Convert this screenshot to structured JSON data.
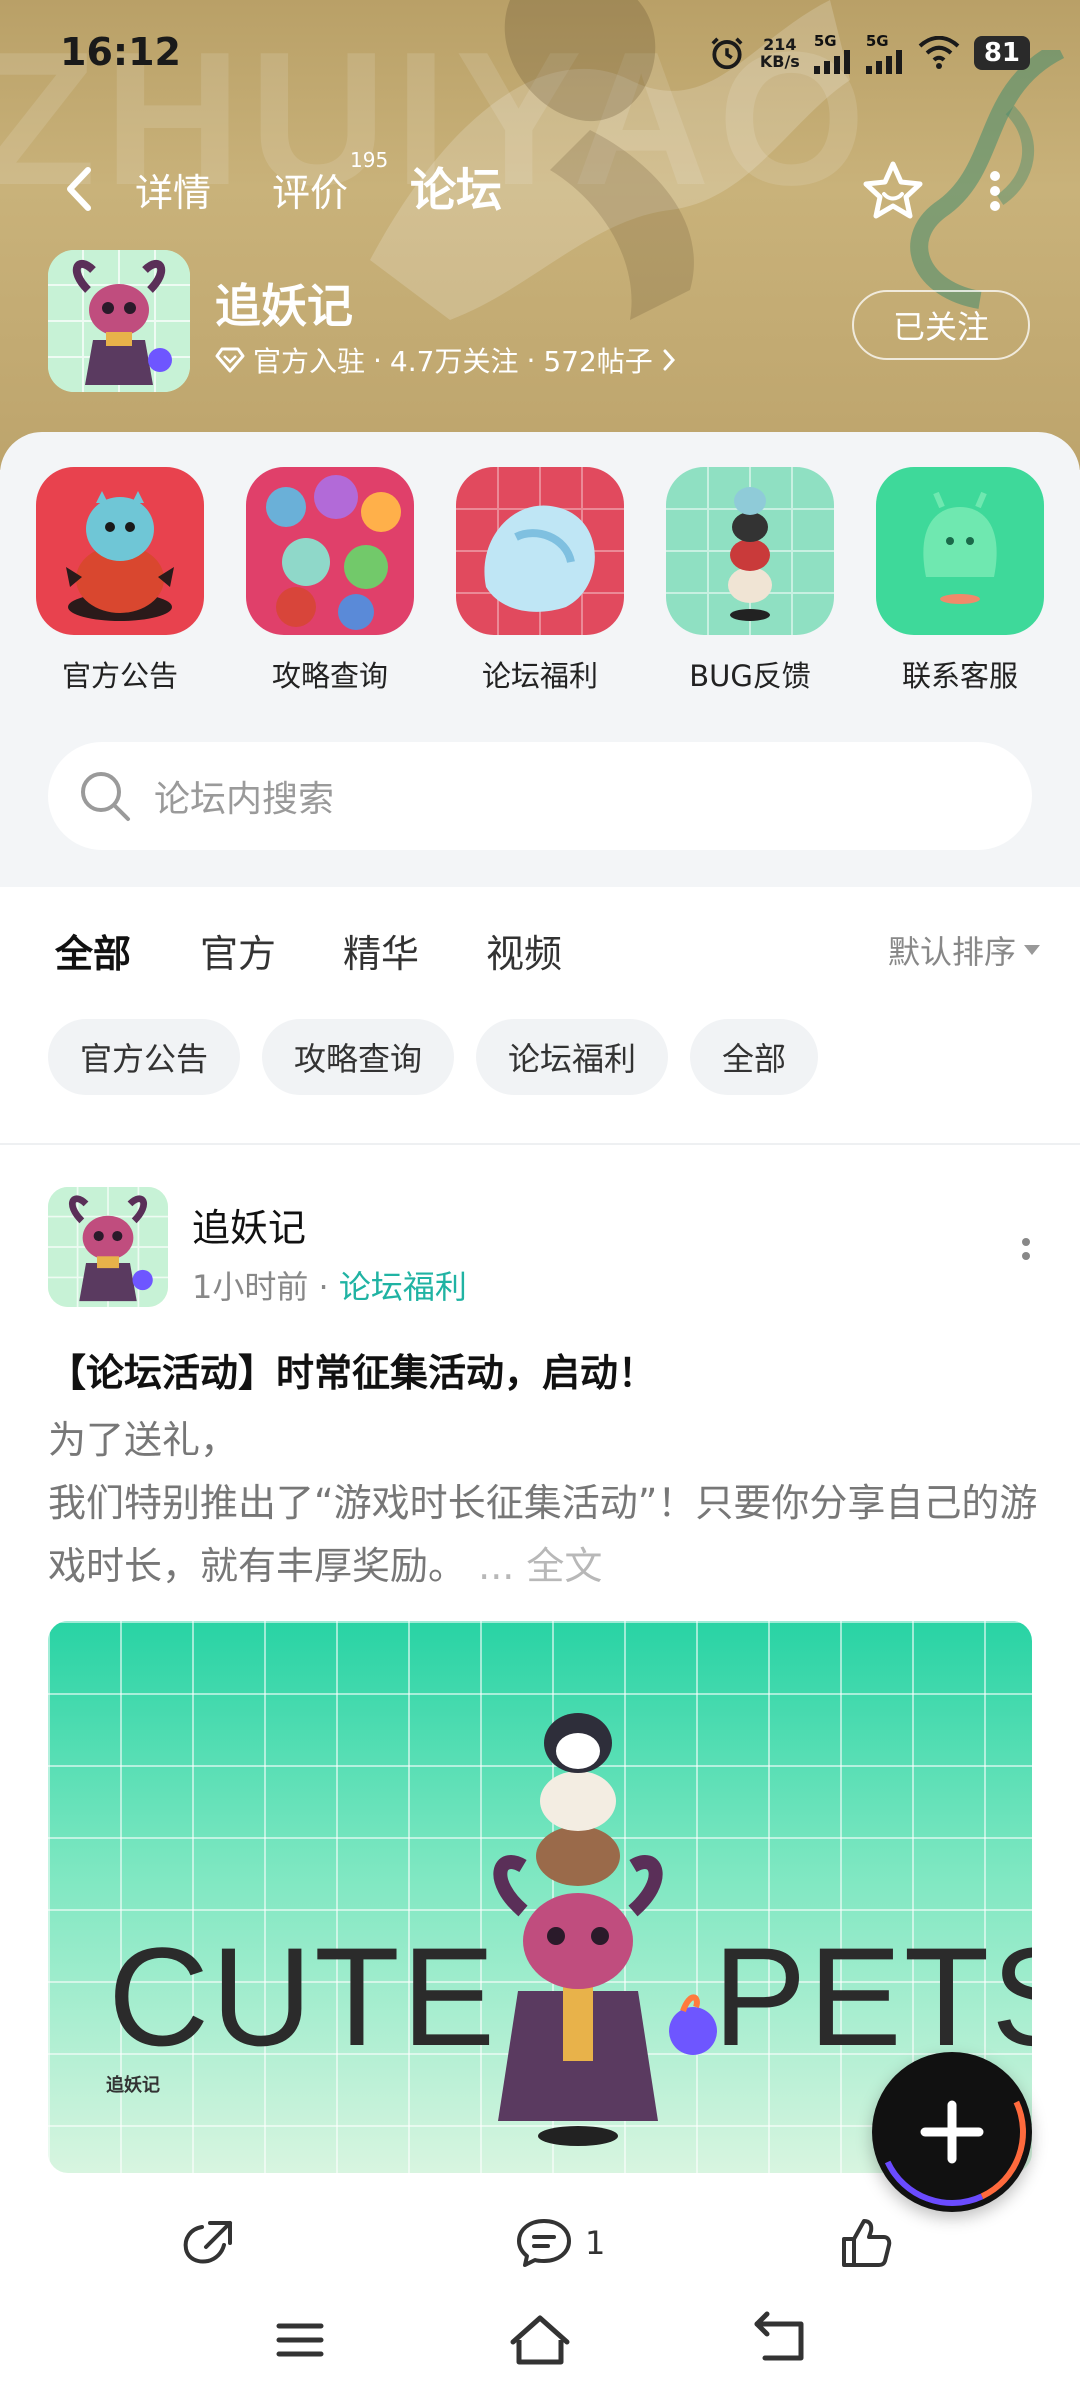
{
  "status_bar": {
    "time": "16:12",
    "network_speed": "214",
    "network_speed_unit": "KB/s",
    "signal1": "5G",
    "signal2": "5G",
    "battery": "81"
  },
  "nav": {
    "tabs": [
      {
        "label": "详情"
      },
      {
        "label": "评价",
        "badge": "195"
      },
      {
        "label": "论坛",
        "active": true
      }
    ]
  },
  "game": {
    "name": "追妖记",
    "official": "官方入驻",
    "followers": "4.7万关注",
    "posts": "572帖子",
    "follow_button": "已关注"
  },
  "shortcuts": [
    {
      "label": "官方公告",
      "icon": "red-monster-icon"
    },
    {
      "label": "攻略查询",
      "icon": "monster-group-icon"
    },
    {
      "label": "论坛福利",
      "icon": "ice-monster-icon"
    },
    {
      "label": "BUG反馈",
      "icon": "stacked-pets-icon"
    },
    {
      "label": "联系客服",
      "icon": "green-ghost-icon"
    }
  ],
  "search": {
    "placeholder": "论坛内搜索"
  },
  "filter_tabs": [
    "全部",
    "官方",
    "精华",
    "视频"
  ],
  "sort_label": "默认排序",
  "chips": [
    "官方公告",
    "攻略查询",
    "论坛福利",
    "全部"
  ],
  "post": {
    "author": "追妖记",
    "time": "1小时前",
    "category": "论坛福利",
    "title": "【论坛活动】时常征集活动，启动！",
    "body_line1": "为了送礼，",
    "body_line2": "我们特别推出了“游戏时长征集活动”！只要你分享自己的游戏时长，就有丰厚奖励。",
    "more": "... 全文",
    "image_text_left": "CUTE",
    "image_text_right": "PETS",
    "image_logo": "追妖记",
    "comment_count": "1"
  },
  "colors": {
    "accent": "#20c7b4",
    "banner": "#c4ab74",
    "panel_bg": "#f3f5f7"
  }
}
